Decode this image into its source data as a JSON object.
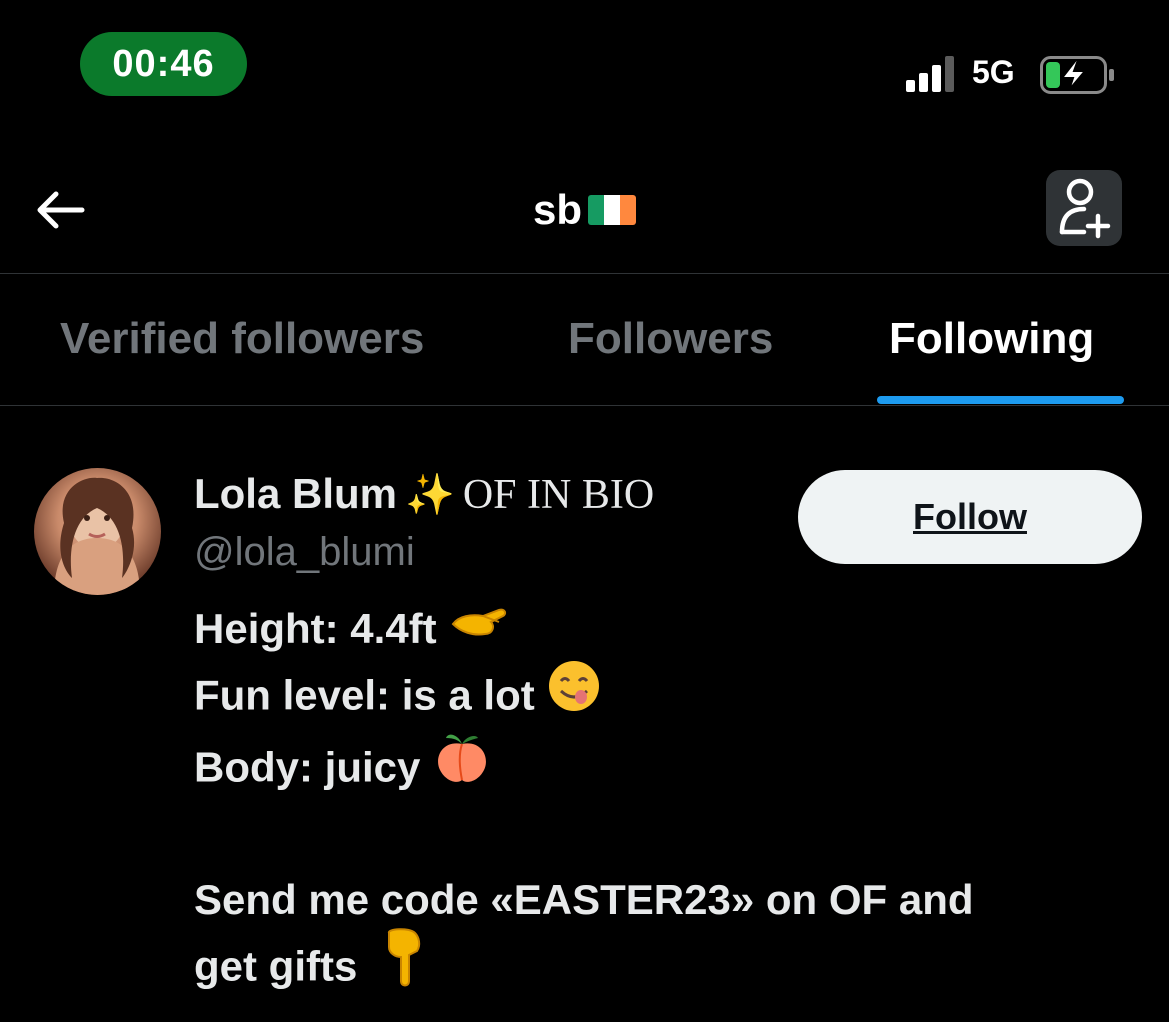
{
  "status_bar": {
    "time": "00:46",
    "network": "5G"
  },
  "header": {
    "title": "sb",
    "flag": "irish-flag-icon"
  },
  "tabs": [
    {
      "label": "Verified followers",
      "active": false
    },
    {
      "label": "Followers",
      "active": false
    },
    {
      "label": "Following",
      "active": true
    }
  ],
  "user": {
    "display_name": "Lola Blum",
    "name_suffix": "OF IN BIO",
    "handle": "@lola_blumi",
    "follow_label": "Follow",
    "bio_lines": [
      "Height: 4.4ft",
      "Fun level: is a lot",
      "Body: juicy",
      "",
      "Send me code «EASTER23» on OF and",
      "get gifts"
    ]
  },
  "colors": {
    "background": "#000000",
    "accent": "#1d9bf0",
    "time_pill": "#0b7a2b",
    "muted_text": "#71767b",
    "divider": "#2f3336"
  }
}
